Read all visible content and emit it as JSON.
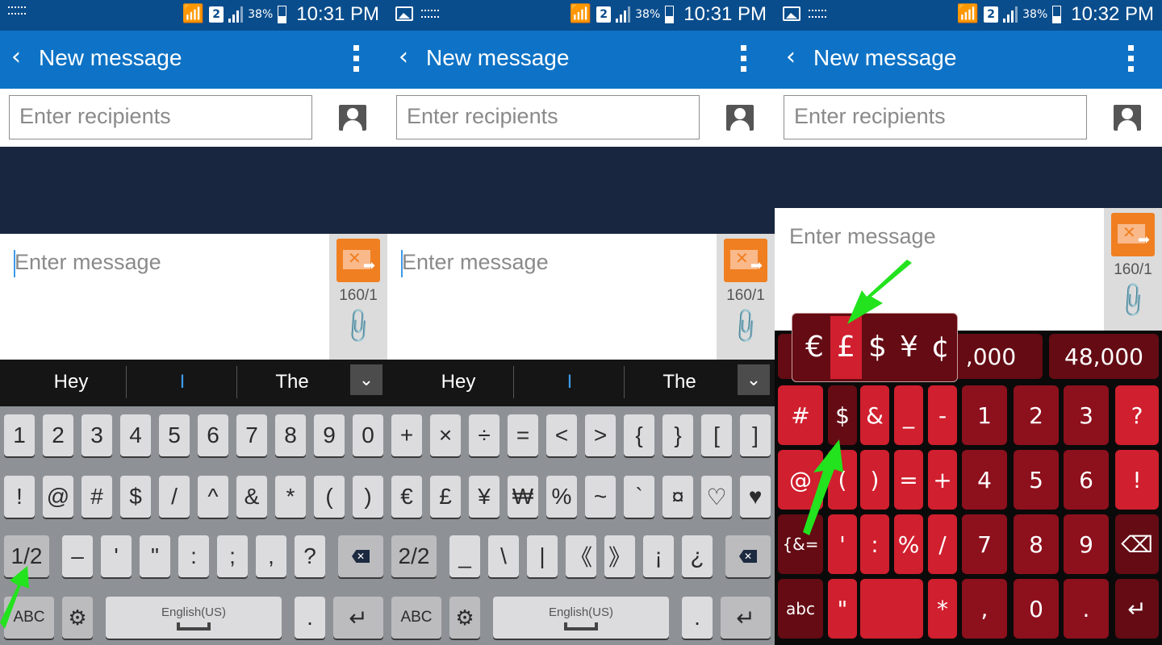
{
  "panels": [
    {
      "status": {
        "time": "10:31 PM",
        "battery": "38%",
        "sim": "2",
        "left_icons": [
          "keyboard-icon"
        ]
      },
      "appbar": {
        "title": "New message",
        "back": "‹",
        "more": "⋮"
      },
      "recipients": {
        "placeholder": "Enter recipients"
      },
      "compose": {
        "placeholder": "Enter message",
        "counter": "160/1"
      },
      "suggestions": [
        "Hey",
        "I",
        "The"
      ],
      "keyboard": {
        "page": "1/2",
        "row1": [
          "1",
          "2",
          "3",
          "4",
          "5",
          "6",
          "7",
          "8",
          "9",
          "0"
        ],
        "row2": [
          "!",
          "@",
          "#",
          "$",
          "/",
          "^",
          "&",
          "*",
          "(",
          ")"
        ],
        "row3": [
          "–",
          "'",
          "\"",
          ":",
          ";",
          ",",
          "?"
        ],
        "abc": "ABC",
        "space_lang": "English(US)",
        "period": ".",
        "period_hint": "••?"
      }
    },
    {
      "status": {
        "time": "10:31 PM",
        "battery": "38%",
        "sim": "2",
        "left_icons": [
          "image-icon",
          "keyboard-icon"
        ]
      },
      "appbar": {
        "title": "New message",
        "back": "‹",
        "more": "⋮"
      },
      "recipients": {
        "placeholder": "Enter recipients"
      },
      "compose": {
        "placeholder": "Enter message",
        "counter": "160/1"
      },
      "suggestions": [
        "Hey",
        "I",
        "The"
      ],
      "keyboard": {
        "page": "2/2",
        "row1": [
          "+",
          "×",
          "÷",
          "=",
          "<",
          ">",
          "{",
          "}",
          "[",
          "]"
        ],
        "row2": [
          "€",
          "£",
          "¥",
          "₩",
          "%",
          "~",
          "`",
          "¤",
          "♡",
          "♥"
        ],
        "row3": [
          "_",
          "\\",
          "|",
          "《",
          "》",
          "¡",
          "¿"
        ],
        "abc": "ABC",
        "space_lang": "English(US)",
        "period": ".",
        "period_hint": "••?"
      }
    },
    {
      "status": {
        "time": "10:32 PM",
        "battery": "38%",
        "sim": "2",
        "left_icons": [
          "image-icon",
          "keyboard-icon"
        ]
      },
      "appbar": {
        "title": "New message",
        "back": "‹",
        "more": "⋮"
      },
      "recipients": {
        "placeholder": "Enter recipients"
      },
      "compose": {
        "placeholder": "Enter message",
        "counter": "160/1"
      },
      "currency_popup": {
        "options": [
          "€",
          "£",
          "$",
          "¥",
          "¢"
        ],
        "selected": "£"
      },
      "number_suggestions": [
        ",000",
        "48,000"
      ],
      "keyboard": {
        "rows": [
          [
            "#",
            "$",
            "&",
            "_",
            "-",
            "1",
            "2",
            "3",
            "?"
          ],
          [
            "@",
            "(",
            ")",
            "=",
            "+",
            "4",
            "5",
            "6",
            "!"
          ],
          [
            "{&=",
            "'",
            ":",
            "%",
            "/",
            "7",
            "8",
            "9",
            "⌫"
          ],
          [
            "abc",
            "\"",
            " ",
            "*",
            ",",
            "0",
            ".",
            "↵"
          ]
        ],
        "emoji_hint": "☺"
      }
    }
  ],
  "colors": {
    "appbar": "#0e73c6",
    "status": "#0a4d8c",
    "send": "#f07f22",
    "red_light": "#d01f2e",
    "red_mid": "#8d101d",
    "red_dark": "#640b14",
    "arrow": "#22e31d"
  }
}
